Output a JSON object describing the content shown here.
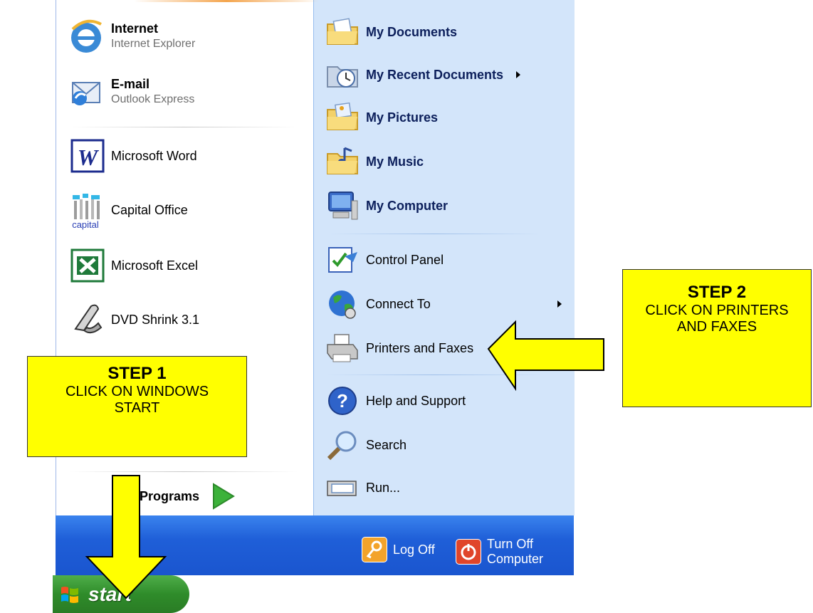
{
  "start_menu": {
    "pinned": [
      {
        "title": "Internet",
        "subtitle": "Internet Explorer"
      },
      {
        "title": "E-mail",
        "subtitle": "Outlook Express"
      }
    ],
    "recent": [
      {
        "label": "Microsoft Word"
      },
      {
        "label": "Capital Office",
        "icon_text": "capital"
      },
      {
        "label": "Microsoft Excel"
      },
      {
        "label": "DVD Shrink 3.1"
      }
    ],
    "all_programs_label": "Programs",
    "places": [
      {
        "label": "My Documents"
      },
      {
        "label": "My Recent Documents"
      },
      {
        "label": "My Pictures"
      },
      {
        "label": "My Music"
      },
      {
        "label": "My Computer"
      }
    ],
    "system": [
      {
        "label": "Control Panel"
      },
      {
        "label": "Connect To"
      },
      {
        "label": "Printers and Faxes"
      },
      {
        "label": "Help and Support"
      },
      {
        "label": "Search"
      },
      {
        "label": "Run..."
      }
    ],
    "log_off_label": "Log Off",
    "turn_off_label": "Turn Off Computer"
  },
  "taskbar": {
    "start_label": "start"
  },
  "callouts": {
    "step1": {
      "title": "STEP 1",
      "text": "CLICK ON WINDOWS START"
    },
    "step2": {
      "title": "STEP 2",
      "text": "CLICK ON PRINTERS AND FAXES"
    }
  },
  "colors": {
    "callout_fill": "#ffff00",
    "right_pane": "#d3e5fa",
    "footer_blue": "#1f5fd8",
    "start_green": "#2f8c2a"
  }
}
